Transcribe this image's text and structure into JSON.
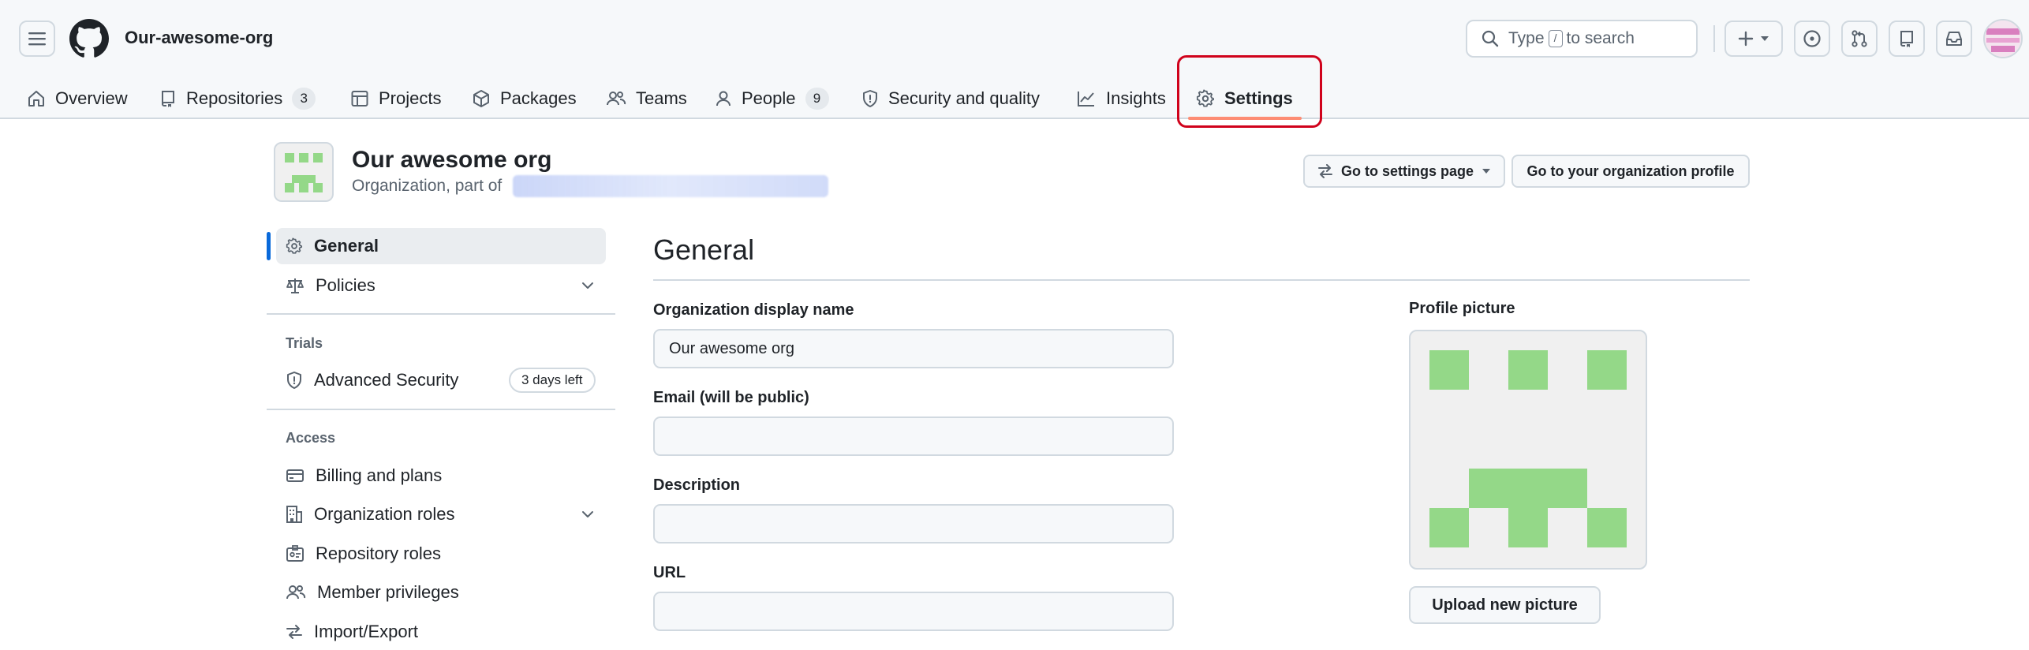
{
  "header": {
    "org_name": "Our-awesome-org",
    "search": {
      "prefix": "Type",
      "key": "/",
      "suffix": "to search"
    }
  },
  "nav": {
    "tabs": [
      {
        "label": "Overview",
        "icon": "home-icon"
      },
      {
        "label": "Repositories",
        "count": "3",
        "icon": "repo-icon"
      },
      {
        "label": "Projects",
        "icon": "table-icon"
      },
      {
        "label": "Packages",
        "icon": "package-icon"
      },
      {
        "label": "Teams",
        "icon": "people-icon"
      },
      {
        "label": "People",
        "count": "9",
        "icon": "person-icon"
      },
      {
        "label": "Security and quality",
        "icon": "shield-icon"
      },
      {
        "label": "Insights",
        "icon": "graph-icon"
      },
      {
        "label": "Settings",
        "icon": "gear-icon",
        "active": true
      }
    ]
  },
  "org": {
    "title": "Our awesome org",
    "subtitle": "Organization, part of"
  },
  "actions": {
    "settings_page": "Go to settings page",
    "org_profile": "Go to your organization profile"
  },
  "sidebar": {
    "items": {
      "general": "General",
      "policies": "Policies",
      "advanced_security": "Advanced Security",
      "billing": "Billing and plans",
      "org_roles": "Organization roles",
      "repo_roles": "Repository roles",
      "member_privileges": "Member privileges",
      "import_export": "Import/Export"
    },
    "headings": {
      "trials": "Trials",
      "access": "Access"
    },
    "trial_badge": "3 days left"
  },
  "main": {
    "title": "General",
    "fields": {
      "display_name": {
        "label": "Organization display name",
        "value": "Our awesome org"
      },
      "email": {
        "label": "Email (will be public)",
        "value": ""
      },
      "description": {
        "label": "Description",
        "value": ""
      },
      "url": {
        "label": "URL",
        "value": ""
      }
    },
    "profile_picture": {
      "label": "Profile picture",
      "upload": "Upload new picture"
    }
  },
  "colors": {
    "accent_blue": "#0969da",
    "tab_underline": "#fd8c73",
    "highlight_red": "#d0021b",
    "identicon_green": "#94d888"
  }
}
